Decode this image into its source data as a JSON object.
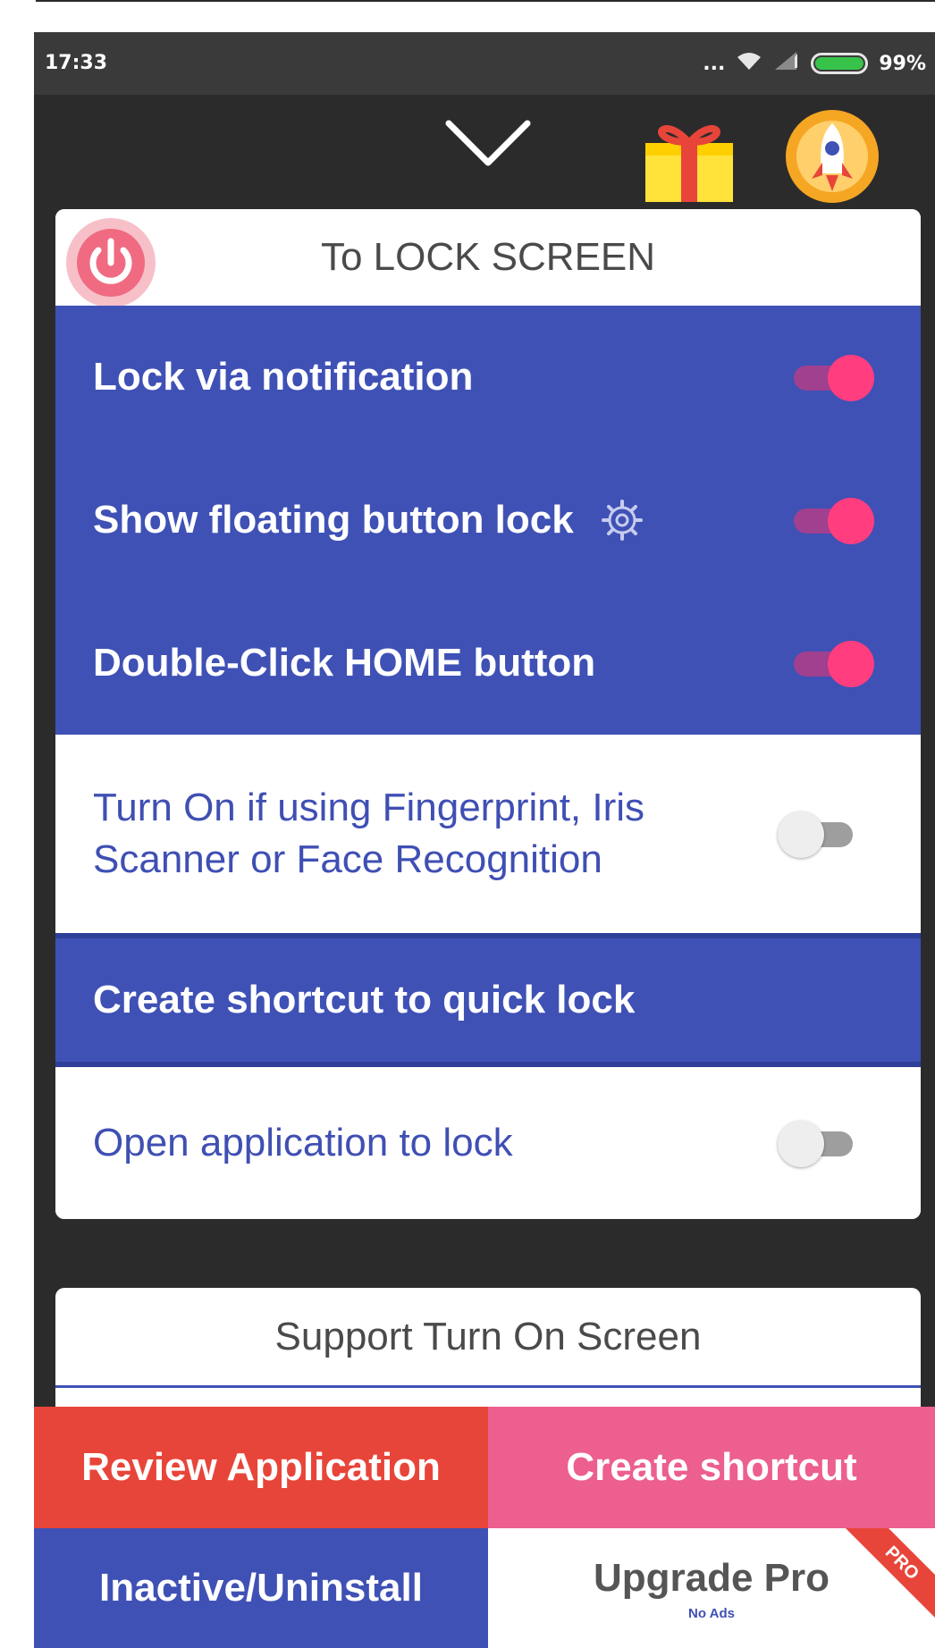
{
  "status_bar": {
    "time": "17:33",
    "dots": "...",
    "battery_percent": "99%",
    "battery_level": 0.99
  },
  "toolbar": {
    "collapse_icon": "chevron-down-icon",
    "gift_icon": "gift-icon",
    "avatar_icon": "rocket-avatar-icon"
  },
  "lock_card": {
    "title": "To LOCK SCREEN",
    "power_icon": "power-icon",
    "rows": [
      {
        "label": "Lock via notification",
        "toggle": true,
        "style": "blue"
      },
      {
        "label": "Show floating button lock",
        "toggle": true,
        "style": "blue",
        "has_gear": true
      },
      {
        "label": "Double-Click HOME button",
        "toggle": true,
        "style": "blue"
      },
      {
        "label": "Turn On if using Fingerprint, Iris Scanner or Face Recognition",
        "toggle": false,
        "style": "white"
      },
      {
        "label": "Create shortcut to quick lock",
        "style": "blue"
      },
      {
        "label": "Open application to lock",
        "toggle": false,
        "style": "white"
      }
    ]
  },
  "support_card": {
    "title": "Support Turn On Screen"
  },
  "bottom_buttons": {
    "review": "Review Application",
    "create_shortcut": "Create shortcut",
    "uninstall": "Inactive/Uninstall",
    "upgrade": "Upgrade Pro",
    "upgrade_sub": "No Ads",
    "ribbon": "PRO"
  },
  "colors": {
    "primary": "#3f51b5",
    "accent": "#ff3d7f",
    "review": "#e8453a",
    "shortcut": "#ec5f8f",
    "background": "#2b2b2b"
  }
}
